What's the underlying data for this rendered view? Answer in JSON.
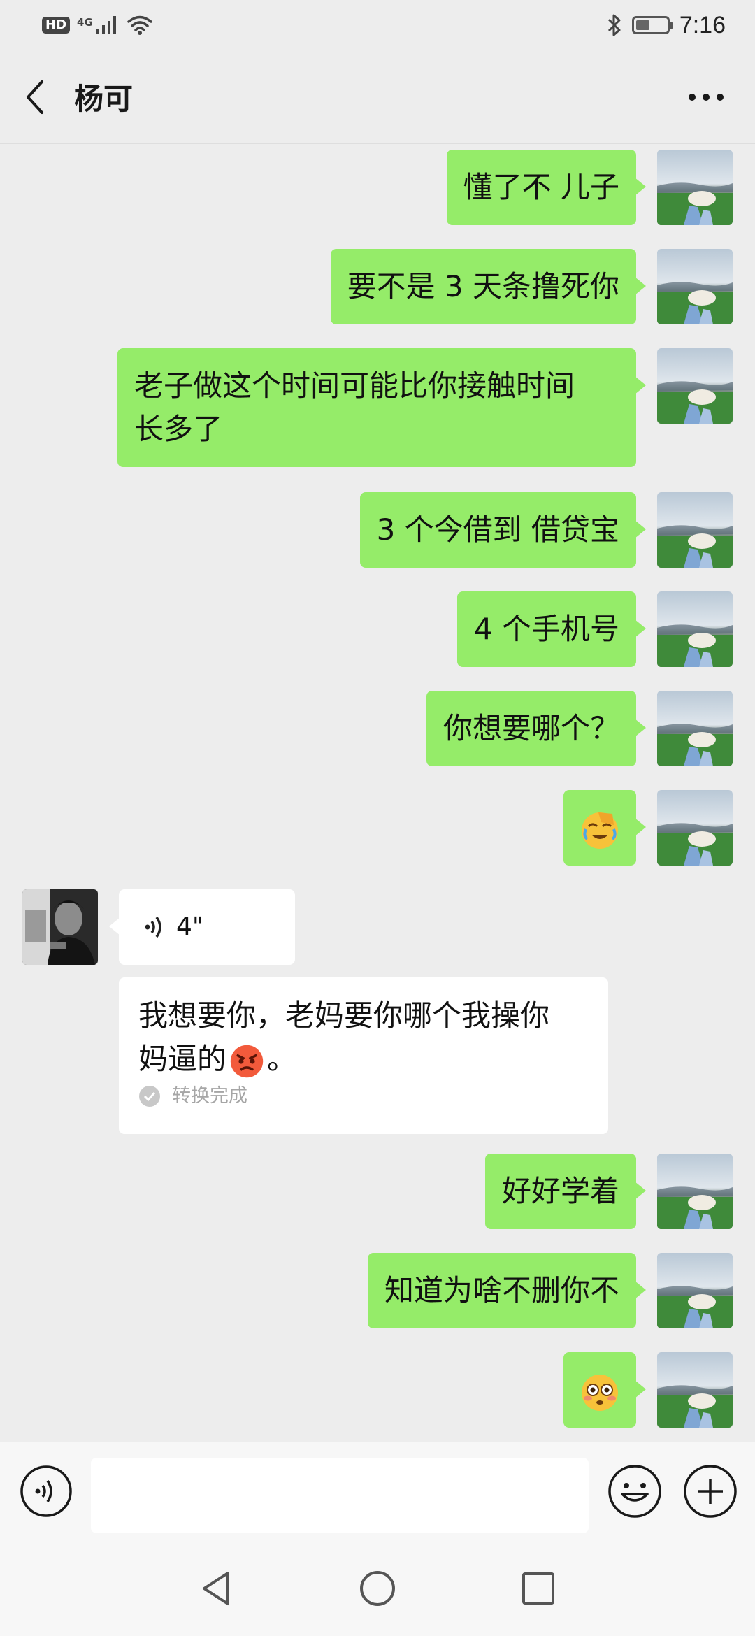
{
  "status_bar": {
    "hd": "HD",
    "network": "4G",
    "time": "7:16",
    "battery_level": 0.45
  },
  "header": {
    "title": "杨可"
  },
  "messages": [
    {
      "direction": "out",
      "text": "懂了不  儿子"
    },
    {
      "direction": "out",
      "text": "要不是 3 天条撸死你"
    },
    {
      "direction": "out",
      "text_lines": [
        "老子做这个时间可能比你接触时间",
        "长多了"
      ]
    },
    {
      "direction": "out",
      "text": "3 个今借到  借贷宝"
    },
    {
      "direction": "out",
      "text": "4 个手机号"
    },
    {
      "direction": "out",
      "text": "你想要哪个？"
    },
    {
      "direction": "out",
      "emoji": "face-palm-crying-icon"
    },
    {
      "direction": "in",
      "voice_duration": "4\""
    },
    {
      "direction": "in",
      "transcript_lines": [
        "我想要你，老妈要你哪个我操你",
        "妈逼的"
      ],
      "transcript_emoji": "angry-face-icon",
      "transcript_end": "。",
      "status": "转换完成"
    },
    {
      "direction": "out",
      "text": "好好学着"
    },
    {
      "direction": "out",
      "text": "知道为啥不删你不"
    },
    {
      "direction": "out",
      "emoji": "flushed-face-icon"
    }
  ],
  "input": {
    "value": ""
  },
  "colors": {
    "bubble_out": "#95ec69",
    "bubble_in": "#ffffff",
    "background": "#ededed"
  }
}
